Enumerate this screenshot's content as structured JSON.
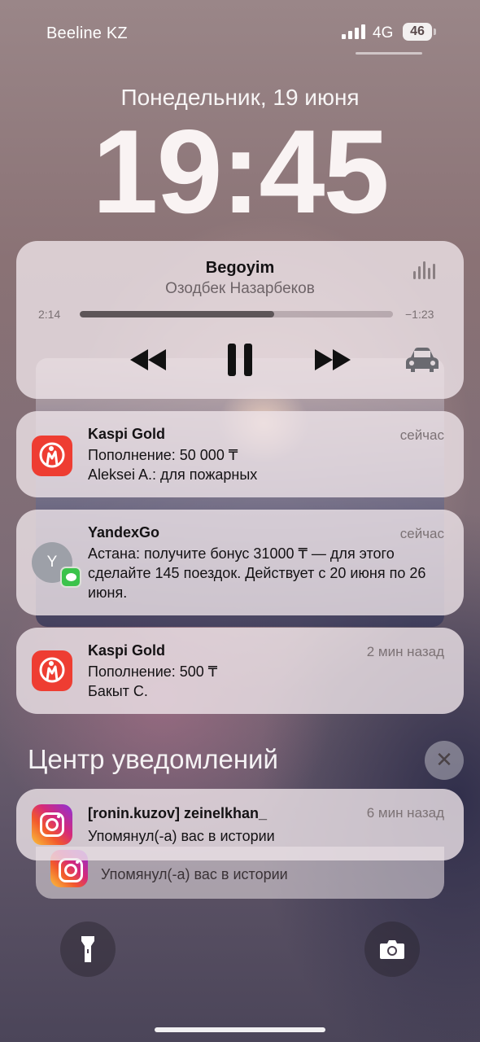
{
  "status_bar": {
    "carrier": "Beeline KZ",
    "network": "4G",
    "battery": "46",
    "icons": [
      "signal-icon",
      "battery-icon"
    ]
  },
  "lockscreen": {
    "date": "Понедельник, 19 июня",
    "time": "19:45"
  },
  "player": {
    "song": "Begoyim",
    "artist": "Озодбек Назарбеков",
    "elapsed": "2:14",
    "remaining": "−1:23",
    "progress": 0.62,
    "icons": [
      "waveform-icon",
      "rewind-icon",
      "pause-icon",
      "fast-forward-icon",
      "car-icon"
    ]
  },
  "notifications": [
    {
      "app": "Kaspi Gold",
      "time": "сейчас",
      "line1": "Пополнение: 50 000 ₸",
      "line2": "Aleksei A.: для пожарных",
      "icon": "kaspi-icon",
      "accent": "#ee3d32"
    },
    {
      "app": "YandexGo",
      "time": "сейчас",
      "avatar_letter": "Y",
      "body": "Астана: получите бонус 31000 ₸ — для этого сделайте 145 поездок. Действует с 20 июня по 26 июня.",
      "icon": "messages-icon",
      "accent": "#3bc34b"
    },
    {
      "app": "Kaspi Gold",
      "time": "2 мин назад",
      "line1": "Пополнение: 500 ₸",
      "line2": "Бакыт С.",
      "icon": "kaspi-icon",
      "accent": "#ee3d32"
    }
  ],
  "notification_center": {
    "title": "Центр уведомлений",
    "close_icon": "close-icon",
    "items": [
      {
        "title": "[ronin.kuzov] zeinelkhan_",
        "time": "6 мин назад",
        "body": "Упомянул(-а) вас в истории",
        "icon": "instagram-icon"
      },
      {
        "body": "Упомянул(-а) вас в истории",
        "icon": "instagram-icon"
      }
    ]
  },
  "bottom_controls": [
    "flashlight-icon",
    "camera-icon"
  ]
}
